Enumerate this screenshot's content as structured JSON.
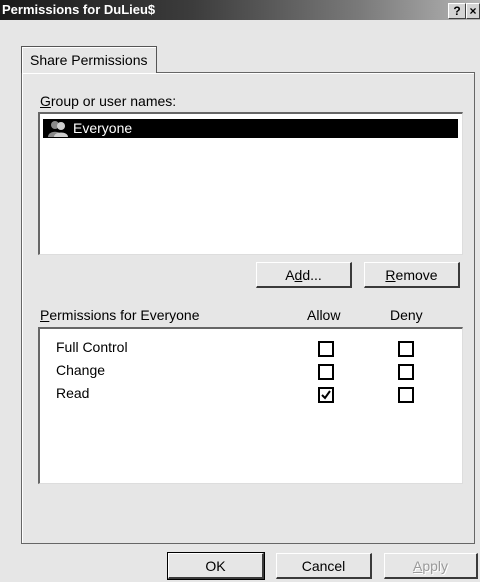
{
  "window": {
    "title": "Permissions for DuLieu$"
  },
  "title_buttons": {
    "help": "?",
    "close": "×"
  },
  "tabs": [
    {
      "label": "Share Permissions"
    }
  ],
  "group": {
    "label": "Group or user names:",
    "users": [
      {
        "name": "Everyone",
        "selected": true,
        "icon": "group-users-icon"
      }
    ]
  },
  "buttons": {
    "add": "Add...",
    "remove": "Remove"
  },
  "permissions": {
    "label": "Permissions for Everyone",
    "allow_header": "Allow",
    "deny_header": "Deny",
    "rows": [
      {
        "name": "Full Control",
        "allow": false,
        "deny": false
      },
      {
        "name": "Change",
        "allow": false,
        "deny": false
      },
      {
        "name": "Read",
        "allow": true,
        "deny": false
      }
    ]
  },
  "footer": {
    "ok": "OK",
    "cancel": "Cancel",
    "apply": "Apply",
    "apply_enabled": false
  }
}
